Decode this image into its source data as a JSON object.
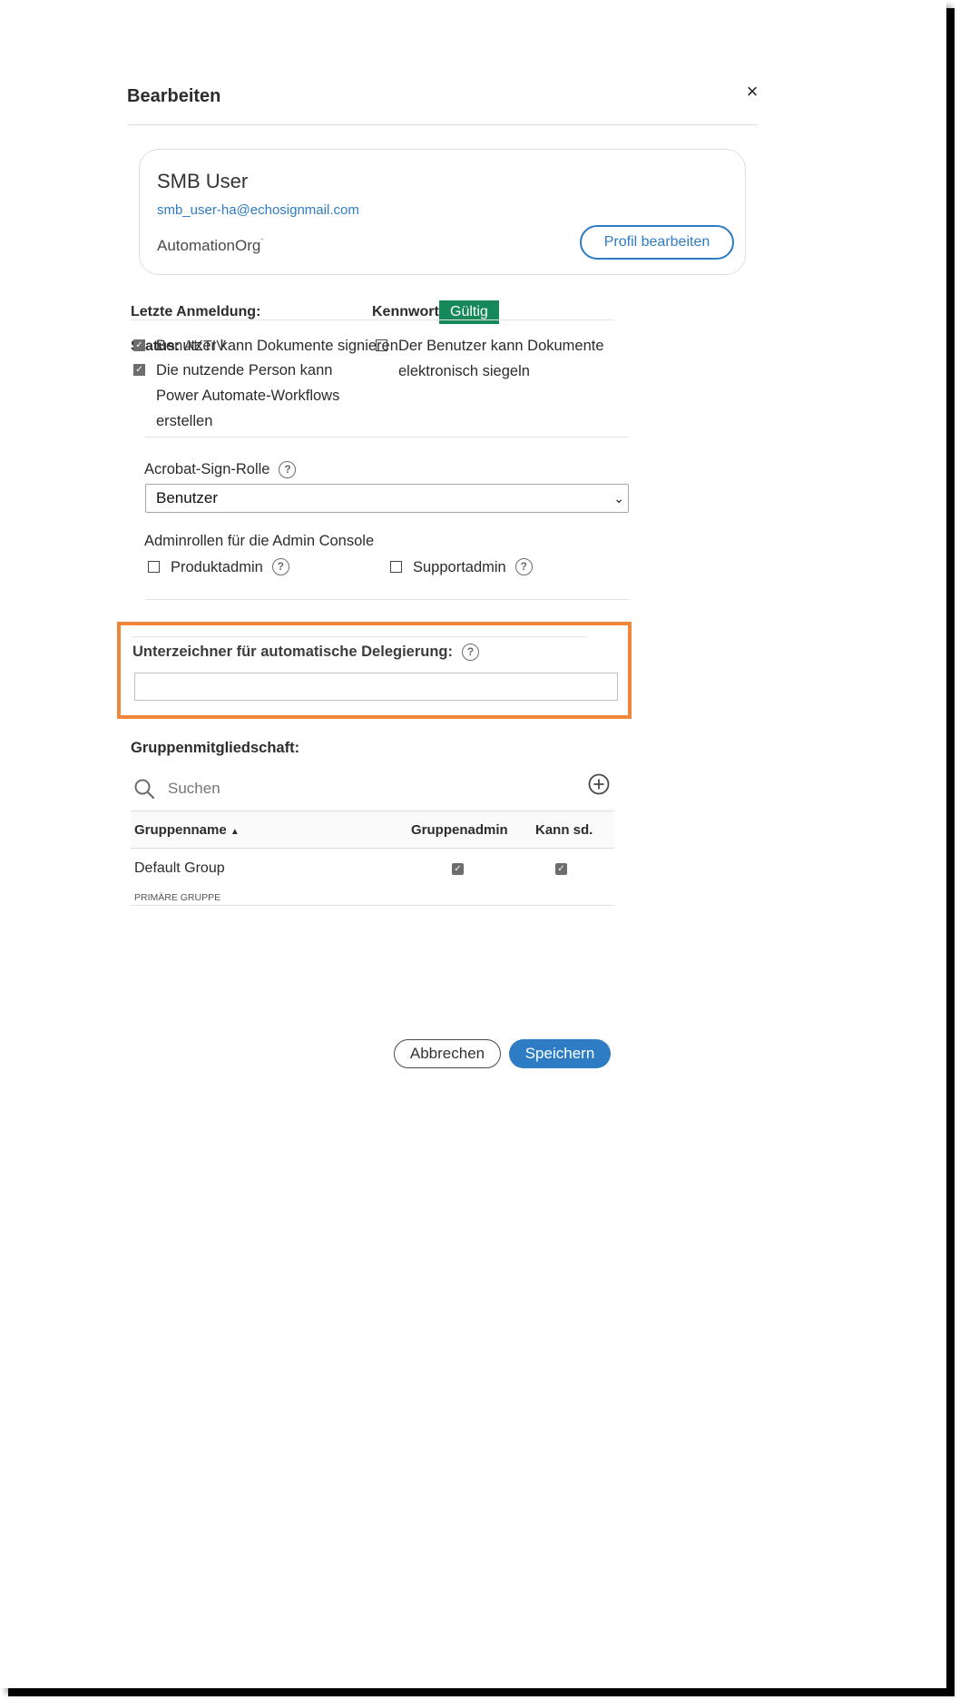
{
  "dialog": {
    "title": "Bearbeiten",
    "close_label": "×"
  },
  "profile": {
    "name": "SMB User",
    "email": "smb_user-ha@echosignmail.com",
    "org": "AutomationOrg",
    "org_mark": "¨",
    "edit_button": "Profil bearbeiten"
  },
  "meta": {
    "last_login_label": "Letzte Anmeldung:",
    "password_label": "Kennwort:",
    "password_status": "Gültig",
    "status_label": "Status:",
    "status_value": "AKTIV"
  },
  "permissions": [
    {
      "label": "Benutzer kann Dokumente signieren",
      "checked": true
    },
    {
      "label": "Die nutzende Person kann Power Automate-Workflows erstellen",
      "checked": true
    },
    {
      "label": "Der Benutzer kann Dokumente elektronisch siegeln",
      "checked": false
    }
  ],
  "role": {
    "label": "Acrobat-Sign-Rolle",
    "selected": "Benutzer"
  },
  "admin_roles": {
    "label": "Adminrollen für die Admin Console",
    "items": [
      {
        "label": "Produktadmin",
        "checked": false
      },
      {
        "label": "Supportadmin",
        "checked": false
      }
    ]
  },
  "delegation": {
    "label": "Unterzeichner für automatische Delegierung:",
    "value": ""
  },
  "groups": {
    "title": "Gruppenmitgliedschaft:",
    "search_placeholder": "Suchen",
    "columns": {
      "name": "Gruppenname",
      "sort_indicator": "▲",
      "admin": "Gruppenadmin",
      "can_send": "Kann sd."
    },
    "rows": [
      {
        "name": "Default Group",
        "subtitle": "PRIMÄRE GRUPPE",
        "admin": true,
        "can_send": true
      }
    ]
  },
  "footer": {
    "cancel": "Abbrechen",
    "save": "Speichern"
  },
  "colors": {
    "accent": "#2d7cc4",
    "valid_badge": "#16885a",
    "highlight": "#f0863a"
  }
}
